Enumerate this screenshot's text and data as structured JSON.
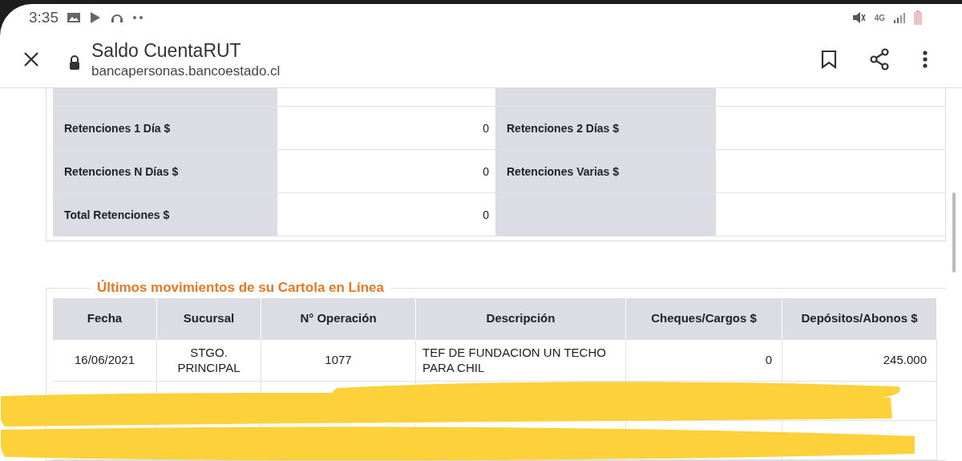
{
  "status_bar": {
    "time": "3:35",
    "network": "4G"
  },
  "toolbar": {
    "title": "Saldo CuentaRUT",
    "url": "bancapersonas.bancoestado.cl"
  },
  "retentions": [
    {
      "label": "Retenciones 1 Día $",
      "value": "0",
      "label_2": "Retenciones 2 Días $"
    },
    {
      "label": "Retenciones N Días $",
      "value": "0",
      "label_2": "Retenciones Varias $"
    },
    {
      "label": "Total Retenciones $",
      "value": "0"
    }
  ],
  "movements": {
    "title": "Últimos movimientos de su Cartola en Línea",
    "columns": [
      "Fecha",
      "Sucursal",
      "N° Operación",
      "Descripción",
      "Cheques/Cargos $",
      "Depósitos/Abonos $"
    ],
    "rows": [
      [
        "16/06/2021",
        "STGO. PRINCIPAL",
        "1077",
        "TEF DE FUNDACION UN TECHO PARA CHIL",
        "0",
        "245.000"
      ]
    ]
  }
}
